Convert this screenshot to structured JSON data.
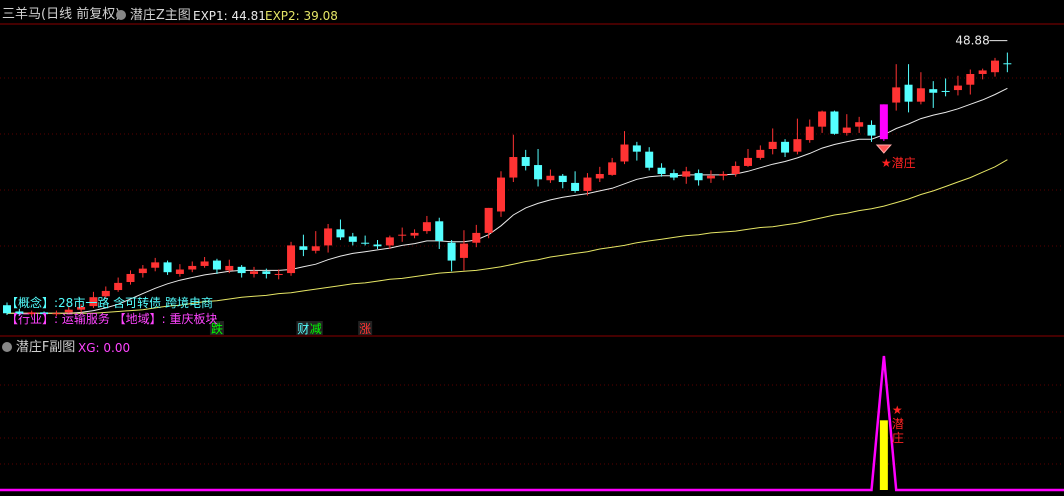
{
  "colors": {
    "up": "#ff3333",
    "down": "#54ffff",
    "ma1": "#e8e8e8",
    "ma2": "#e5e565",
    "magenta": "#ff00ff",
    "yellow": "#ffff00",
    "grid": "#5a0000",
    "label": "#54ffff",
    "star": "#ff2222"
  },
  "header": {
    "title": "三羊马(日线 前复权)",
    "indicator": "潜庄Z主图",
    "exp1_label": "EXP1:",
    "exp1_value": "44.81",
    "exp2_label": "EXP2:",
    "exp2_value": "39.08"
  },
  "info": {
    "concept_line": "【概念】:28市一路 含可转债 跨境电商",
    "industry_line": "【行业】:  运输服务 【地域】: 重庆板块"
  },
  "markers": [
    {
      "text": "跌",
      "color": "#00ff00",
      "index": 17
    },
    {
      "text": "财",
      "color": "#54ffff",
      "index": 24
    },
    {
      "text": "减",
      "color": "#00ff00",
      "index": 25
    },
    {
      "text": "涨",
      "color": "#ff3333",
      "index": 29
    }
  ],
  "star_label": "潜庄",
  "sub": {
    "title": "潜庄F副图",
    "xg_label": "XG:",
    "xg_value": "0.00",
    "star_label": "潜庄"
  },
  "chart_data": [
    {
      "type": "candlestick",
      "title": "潜庄Z主图",
      "price_max_label": "48.88",
      "ylim": [
        17.5,
        52
      ],
      "candles": [
        [
          20.5,
          19.6,
          20.8,
          19.4
        ],
        [
          19.8,
          19.5,
          20.1,
          19.3
        ],
        [
          19.5,
          19.7,
          19.9,
          19.3
        ],
        [
          19.7,
          19.5,
          19.8,
          19.4
        ],
        [
          19.5,
          19.6,
          19.9,
          19.3
        ],
        [
          19.7,
          20.0,
          20.3,
          19.6
        ],
        [
          20.0,
          20.3,
          20.6,
          19.7
        ],
        [
          20.4,
          21.4,
          22.0,
          20.2
        ],
        [
          21.5,
          22.1,
          22.6,
          21.2
        ],
        [
          22.2,
          23.0,
          23.6,
          22.0
        ],
        [
          23.1,
          24.0,
          24.4,
          22.8
        ],
        [
          24.1,
          24.6,
          25.0,
          23.6
        ],
        [
          24.7,
          25.3,
          25.8,
          24.3
        ],
        [
          25.3,
          24.2,
          25.5,
          23.9
        ],
        [
          24.0,
          24.5,
          25.1,
          23.7
        ],
        [
          24.5,
          24.9,
          25.4,
          24.2
        ],
        [
          24.9,
          25.4,
          25.9,
          24.7
        ],
        [
          25.5,
          24.5,
          25.7,
          24.0
        ],
        [
          24.4,
          24.9,
          25.6,
          24.1
        ],
        [
          24.8,
          24.1,
          25.0,
          23.6
        ],
        [
          24.0,
          24.3,
          24.8,
          23.6
        ],
        [
          24.3,
          24.0,
          24.6,
          23.5
        ],
        [
          23.9,
          24.0,
          24.5,
          23.4
        ],
        [
          24.1,
          27.2,
          27.6,
          23.8
        ],
        [
          27.1,
          26.7,
          28.4,
          26.0
        ],
        [
          26.6,
          27.1,
          28.8,
          26.3
        ],
        [
          27.2,
          29.1,
          29.6,
          26.4
        ],
        [
          29.0,
          28.1,
          30.1,
          27.8
        ],
        [
          28.2,
          27.6,
          28.6,
          27.2
        ],
        [
          27.5,
          27.4,
          28.3,
          27.2
        ],
        [
          27.3,
          27.1,
          27.8,
          26.8
        ],
        [
          27.2,
          28.1,
          28.3,
          26.8
        ],
        [
          28.3,
          28.4,
          29.2,
          27.6
        ],
        [
          28.3,
          28.6,
          29.0,
          28.0
        ],
        [
          28.8,
          29.8,
          30.5,
          28.5
        ],
        [
          29.9,
          27.7,
          30.3,
          26.8
        ],
        [
          27.5,
          25.5,
          27.8,
          24.3
        ],
        [
          25.8,
          27.4,
          28.9,
          24.4
        ],
        [
          27.5,
          28.6,
          29.5,
          27.0
        ],
        [
          28.6,
          31.4,
          31.4,
          28.0
        ],
        [
          31.0,
          34.8,
          35.5,
          30.4
        ],
        [
          34.8,
          37.1,
          39.6,
          34.3
        ],
        [
          37.1,
          36.1,
          37.9,
          35.6
        ],
        [
          36.2,
          34.6,
          38.0,
          33.8
        ],
        [
          34.5,
          35.0,
          35.7,
          34.2
        ],
        [
          35.0,
          34.3,
          35.2,
          33.6
        ],
        [
          34.2,
          33.3,
          35.5,
          33.1
        ],
        [
          33.3,
          34.8,
          35.3,
          32.8
        ],
        [
          34.7,
          35.2,
          36.0,
          34.3
        ],
        [
          35.1,
          36.5,
          37.0,
          35.0
        ],
        [
          36.6,
          38.5,
          40.0,
          36.3
        ],
        [
          38.4,
          37.7,
          38.8,
          36.7
        ],
        [
          37.7,
          35.9,
          38.2,
          35.6
        ],
        [
          35.9,
          35.2,
          36.4,
          34.9
        ],
        [
          35.3,
          34.8,
          35.7,
          34.5
        ],
        [
          34.9,
          35.5,
          36.0,
          34.1
        ],
        [
          35.3,
          34.5,
          35.7,
          33.9
        ],
        [
          34.7,
          35.0,
          35.6,
          34.2
        ],
        [
          35.0,
          35.2,
          35.5,
          34.5
        ],
        [
          35.2,
          36.1,
          36.6,
          34.9
        ],
        [
          36.1,
          37.0,
          38.0,
          36.0
        ],
        [
          37.0,
          37.9,
          38.4,
          36.8
        ],
        [
          38.0,
          38.8,
          40.3,
          37.4
        ],
        [
          38.8,
          37.6,
          39.1,
          37.1
        ],
        [
          37.7,
          39.1,
          41.4,
          37.4
        ],
        [
          39.0,
          40.5,
          41.3,
          38.7
        ],
        [
          40.5,
          42.2,
          42.3,
          39.8
        ],
        [
          42.2,
          39.7,
          42.3,
          39.6
        ],
        [
          39.8,
          40.4,
          41.9,
          39.5
        ],
        [
          40.5,
          41.0,
          41.6,
          39.8
        ],
        [
          40.7,
          39.5,
          41.2,
          38.8
        ],
        [
          39.1,
          43.0,
          43.0,
          38.9
        ],
        [
          43.2,
          44.9,
          47.5,
          42.3
        ],
        [
          45.2,
          43.3,
          47.5,
          42.1
        ],
        [
          43.3,
          44.8,
          46.6,
          43.0
        ],
        [
          44.7,
          44.3,
          45.6,
          42.6
        ],
        [
          44.5,
          44.4,
          45.9,
          43.9
        ],
        [
          44.6,
          45.1,
          46.2,
          44.0
        ],
        [
          45.2,
          46.4,
          46.9,
          44.1
        ],
        [
          46.4,
          46.8,
          47.0,
          45.8
        ],
        [
          46.6,
          47.9,
          48.2,
          46.1
        ],
        [
          47.6,
          47.5,
          48.8,
          46.6
        ]
      ],
      "series": [
        {
          "values": [
            19.6,
            19.6,
            19.6,
            19.6,
            19.6,
            19.6,
            19.7,
            19.9,
            20.2,
            20.6,
            21.2,
            21.8,
            22.4,
            22.9,
            23.3,
            23.6,
            23.9,
            24.1,
            24.3,
            24.4,
            24.4,
            24.4,
            24.4,
            24.5,
            24.8,
            25.1,
            25.6,
            26.0,
            26.3,
            26.5,
            26.7,
            26.9,
            27.2,
            27.4,
            27.7,
            27.7,
            27.6,
            27.6,
            27.8,
            28.4,
            29.4,
            30.6,
            31.4,
            31.9,
            32.3,
            32.6,
            32.8,
            33.0,
            33.3,
            33.6,
            34.1,
            34.6,
            34.9,
            35.0,
            35.0,
            35.1,
            35.1,
            35.1,
            35.1,
            35.2,
            35.5,
            35.9,
            36.3,
            36.6,
            37.0,
            37.5,
            38.1,
            38.5,
            38.8,
            39.1,
            39.1,
            39.6,
            40.3,
            40.8,
            41.4,
            41.8,
            42.1,
            42.5,
            43.0,
            43.5,
            44.1,
            44.8
          ]
        },
        {
          "values": [
            19.6,
            19.6,
            19.6,
            19.6,
            19.6,
            19.6,
            19.6,
            19.6,
            19.7,
            19.8,
            19.9,
            20.0,
            20.2,
            20.4,
            20.5,
            20.7,
            20.9,
            21.0,
            21.2,
            21.4,
            21.5,
            21.6,
            21.8,
            21.9,
            22.1,
            22.3,
            22.5,
            22.7,
            22.9,
            23.0,
            23.2,
            23.4,
            23.5,
            23.7,
            23.9,
            24.1,
            24.2,
            24.3,
            24.4,
            24.6,
            24.8,
            25.1,
            25.4,
            25.6,
            25.9,
            26.1,
            26.3,
            26.5,
            26.8,
            27.0,
            27.2,
            27.5,
            27.7,
            27.9,
            28.1,
            28.3,
            28.4,
            28.6,
            28.7,
            28.8,
            29.0,
            29.2,
            29.3,
            29.5,
            29.7,
            30.0,
            30.3,
            30.6,
            30.8,
            31.1,
            31.3,
            31.6,
            32.0,
            32.4,
            32.9,
            33.3,
            33.8,
            34.3,
            34.8,
            35.4,
            36.0,
            36.8
          ]
        }
      ],
      "signal_index": 71
    },
    {
      "type": "line",
      "title": "潜庄F副图",
      "ylim": [
        0,
        100
      ],
      "values_note": "spike",
      "series": [
        {
          "values": [
            0,
            0,
            0,
            0,
            0,
            0,
            0,
            0,
            0,
            0,
            0,
            0,
            0,
            0,
            0,
            0,
            0,
            0,
            0,
            0,
            0,
            0,
            0,
            0,
            0,
            0,
            0,
            0,
            0,
            0,
            0,
            0,
            0,
            0,
            0,
            0,
            0,
            0,
            0,
            0,
            0,
            0,
            0,
            0,
            0,
            0,
            0,
            0,
            0,
            0,
            0,
            0,
            0,
            0,
            0,
            0,
            0,
            0,
            0,
            0,
            0,
            0,
            0,
            0,
            0,
            0,
            0,
            0,
            0,
            0,
            0,
            100,
            0,
            0,
            0,
            0,
            0,
            0,
            0,
            0,
            0,
            0
          ]
        }
      ],
      "bar_index": 71,
      "bar_value": 52
    }
  ]
}
